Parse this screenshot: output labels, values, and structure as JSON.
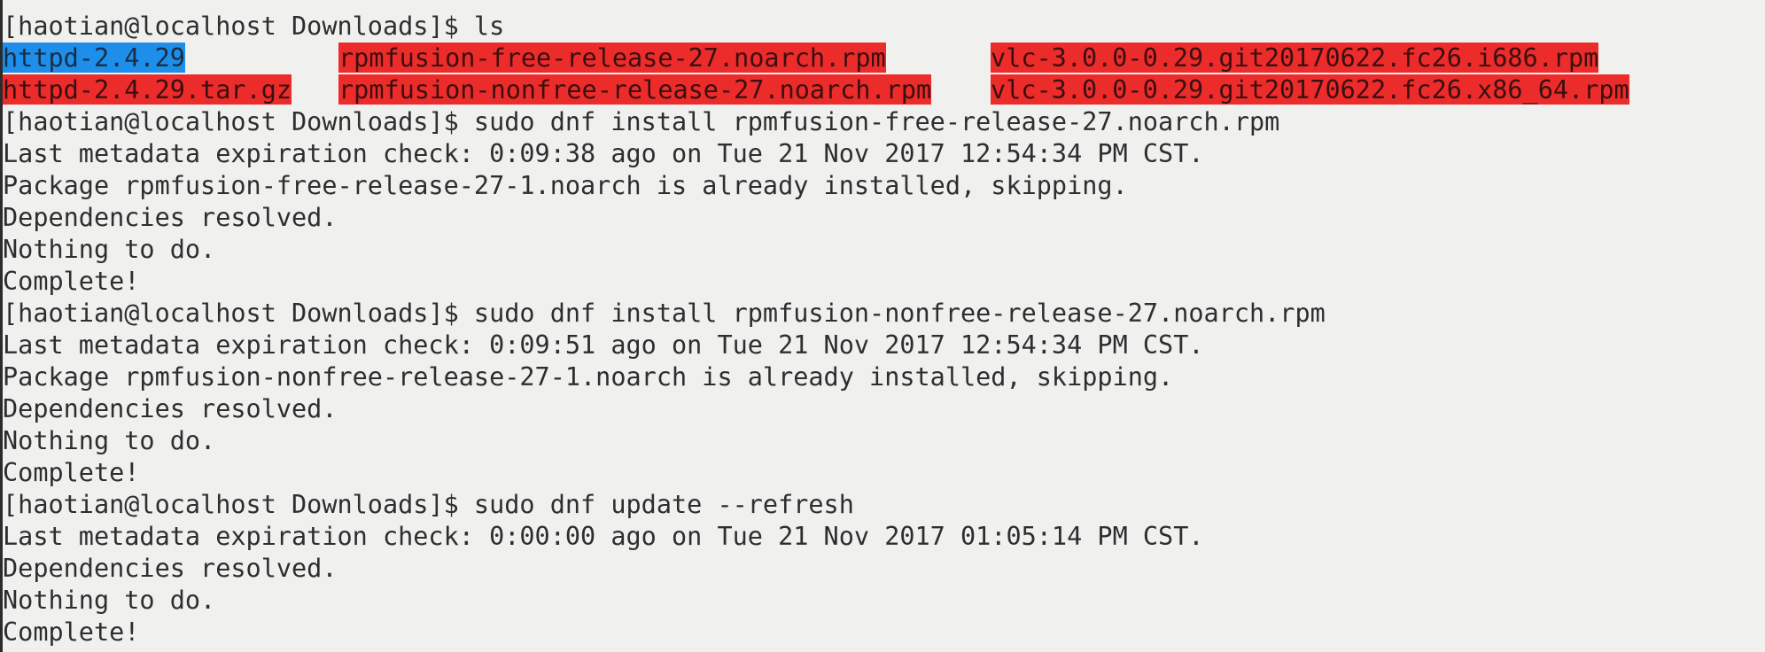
{
  "terminal": {
    "lines_before": [
      "[haotian@localhost Downloads]$ ls"
    ],
    "ls_output": {
      "row1": [
        "httpd-2.4.29",
        "rpmfusion-free-release-27.noarch.rpm",
        "vlc-3.0.0-0.29.git20170622.fc26.i686.rpm"
      ],
      "row2": [
        "httpd-2.4.29.tar.gz",
        "rpmfusion-nonfree-release-27.noarch.rpm",
        "vlc-3.0.0-0.29.git20170622.fc26.x86_64.rpm"
      ]
    },
    "lines_after": [
      "[haotian@localhost Downloads]$ sudo dnf install rpmfusion-free-release-27.noarch.rpm",
      "Last metadata expiration check: 0:09:38 ago on Tue 21 Nov 2017 12:54:34 PM CST.",
      "Package rpmfusion-free-release-27-1.noarch is already installed, skipping.",
      "Dependencies resolved.",
      "Nothing to do.",
      "Complete!",
      "[haotian@localhost Downloads]$ sudo dnf install rpmfusion-nonfree-release-27.noarch.rpm",
      "Last metadata expiration check: 0:09:51 ago on Tue 21 Nov 2017 12:54:34 PM CST.",
      "Package rpmfusion-nonfree-release-27-1.noarch is already installed, skipping.",
      "Dependencies resolved.",
      "Nothing to do.",
      "Complete!",
      "[haotian@localhost Downloads]$ sudo dnf update --refresh",
      "Last metadata expiration check: 0:00:00 ago on Tue 21 Nov 2017 01:05:14 PM CST.",
      "Dependencies resolved.",
      "Nothing to do.",
      "Complete!"
    ]
  },
  "colors": {
    "background": "#f0f0ef",
    "text": "#2e2e2e",
    "directory_highlight": "#1d8ee9",
    "archive_highlight": "#ec2b2b"
  }
}
